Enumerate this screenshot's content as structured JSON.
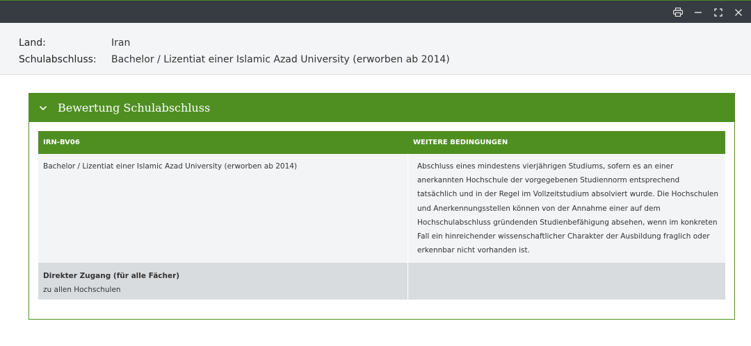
{
  "window": {
    "icons": [
      "print-icon",
      "minimize-icon",
      "maximize-icon",
      "close-icon"
    ]
  },
  "info": {
    "land_label": "Land:",
    "land_value": "Iran",
    "abschluss_label": "Schulabschluss:",
    "abschluss_value": "Bachelor / Lizentiat einer Islamic Azad University (erworben ab 2014)"
  },
  "panel": {
    "title": "Bewertung Schulabschluss",
    "accent_color": "#4f8f22",
    "table": {
      "headers": [
        "IRN-BV06",
        "WEITERE BEDINGUNGEN"
      ],
      "row1": {
        "col1": "Bachelor / Lizentiat einer Islamic Azad University (erworben ab 2014)",
        "col2": "Abschluss eines mindestens vierjährigen Studiums, sofern es an einer anerkannten Hochschule der vorgegebenen Studiennorm entsprechend tatsächlich und in der Regel im Vollzeitstudium absolviert wurde. Die Hochschulen und Anerkennungsstellen können von der Annahme einer auf dem Hochschulabschluss gründenden Studienbefähigung absehen, wenn im konkreten Fall ein hinreichender wissenschaftlicher Charakter der Ausbildung fraglich oder erkennbar nicht vorhanden ist."
      },
      "row2": {
        "title": "Direkter Zugang (für alle Fächer)",
        "subtitle": "zu allen Hochschulen",
        "col2": ""
      }
    }
  }
}
